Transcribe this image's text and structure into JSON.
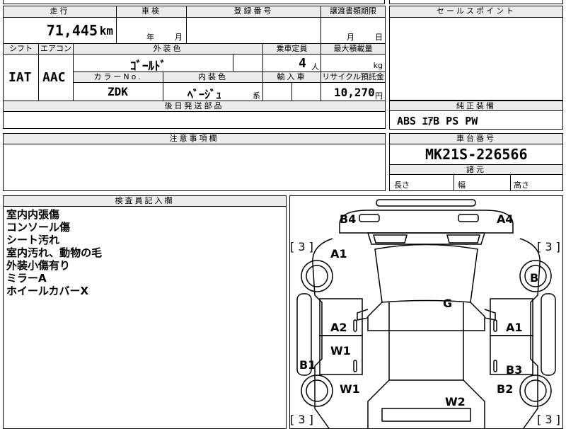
{
  "top": {
    "mileage_label": "走行",
    "mileage_value": "71,445",
    "mileage_unit": "km",
    "inspection_label": "車検",
    "inspection_year_unit": "年",
    "inspection_month_unit": "月",
    "registration_label": "登録番号",
    "transfer_label": "譲渡書類期限",
    "transfer_month_unit": "月",
    "transfer_day_unit": "日",
    "shift_label": "シフト",
    "shift_value": "IAT",
    "ac_label": "エアコン",
    "ac_value": "AAC",
    "ext_color_label": "外装色",
    "ext_color_value": "ｺﾞｰﾙﾄﾞ",
    "capacity_label": "乗車定員",
    "capacity_value": "4",
    "capacity_unit": "人",
    "loadcap_label": "最大積載量",
    "loadcap_unit": "kg",
    "color_no_label": "カラーNo.",
    "color_no_value": "ZDK",
    "int_color_label": "内装色",
    "int_color_value": "ﾍﾞｰｼﾞｭ",
    "int_color_suffix": "系",
    "import_label": "輸入車",
    "recycle_label": "リサイクル預託金",
    "recycle_value": "10,270",
    "recycle_unit": "円",
    "later_parts_label": "後日発送部品"
  },
  "sales_point": {
    "label": "セールスポイント"
  },
  "equipment": {
    "label": "純正装備",
    "value": "ABS ｴｱB PS PW"
  },
  "caution": {
    "label": "注意事項欄"
  },
  "chassis": {
    "label": "車台番号",
    "value": "MK21S-226566",
    "dims_label": "諸元",
    "length_label": "長さ",
    "width_label": "幅",
    "height_label": "高さ"
  },
  "inspector": {
    "label": "検査員記入欄",
    "notes": [
      "室内内張傷",
      "コンソール傷",
      "シート汚れ",
      "室内汚れ、動物の毛",
      "外装小傷有り",
      "ミラーA",
      "ホイールカバーX"
    ]
  },
  "diagram": {
    "tire_left_top": "3",
    "tire_right_top": "3",
    "tire_left_bottom": "3",
    "tire_right_bottom": "3",
    "marks": {
      "b4": "B4",
      "a4": "A4",
      "a1_top": "A1",
      "b_right": "B",
      "g": "G",
      "a2": "A2",
      "a1_right": "A1",
      "w1_mid": "W1",
      "b1": "B1",
      "b3": "B3",
      "w1_low": "W1",
      "b2": "B2",
      "w2": "W2"
    }
  }
}
